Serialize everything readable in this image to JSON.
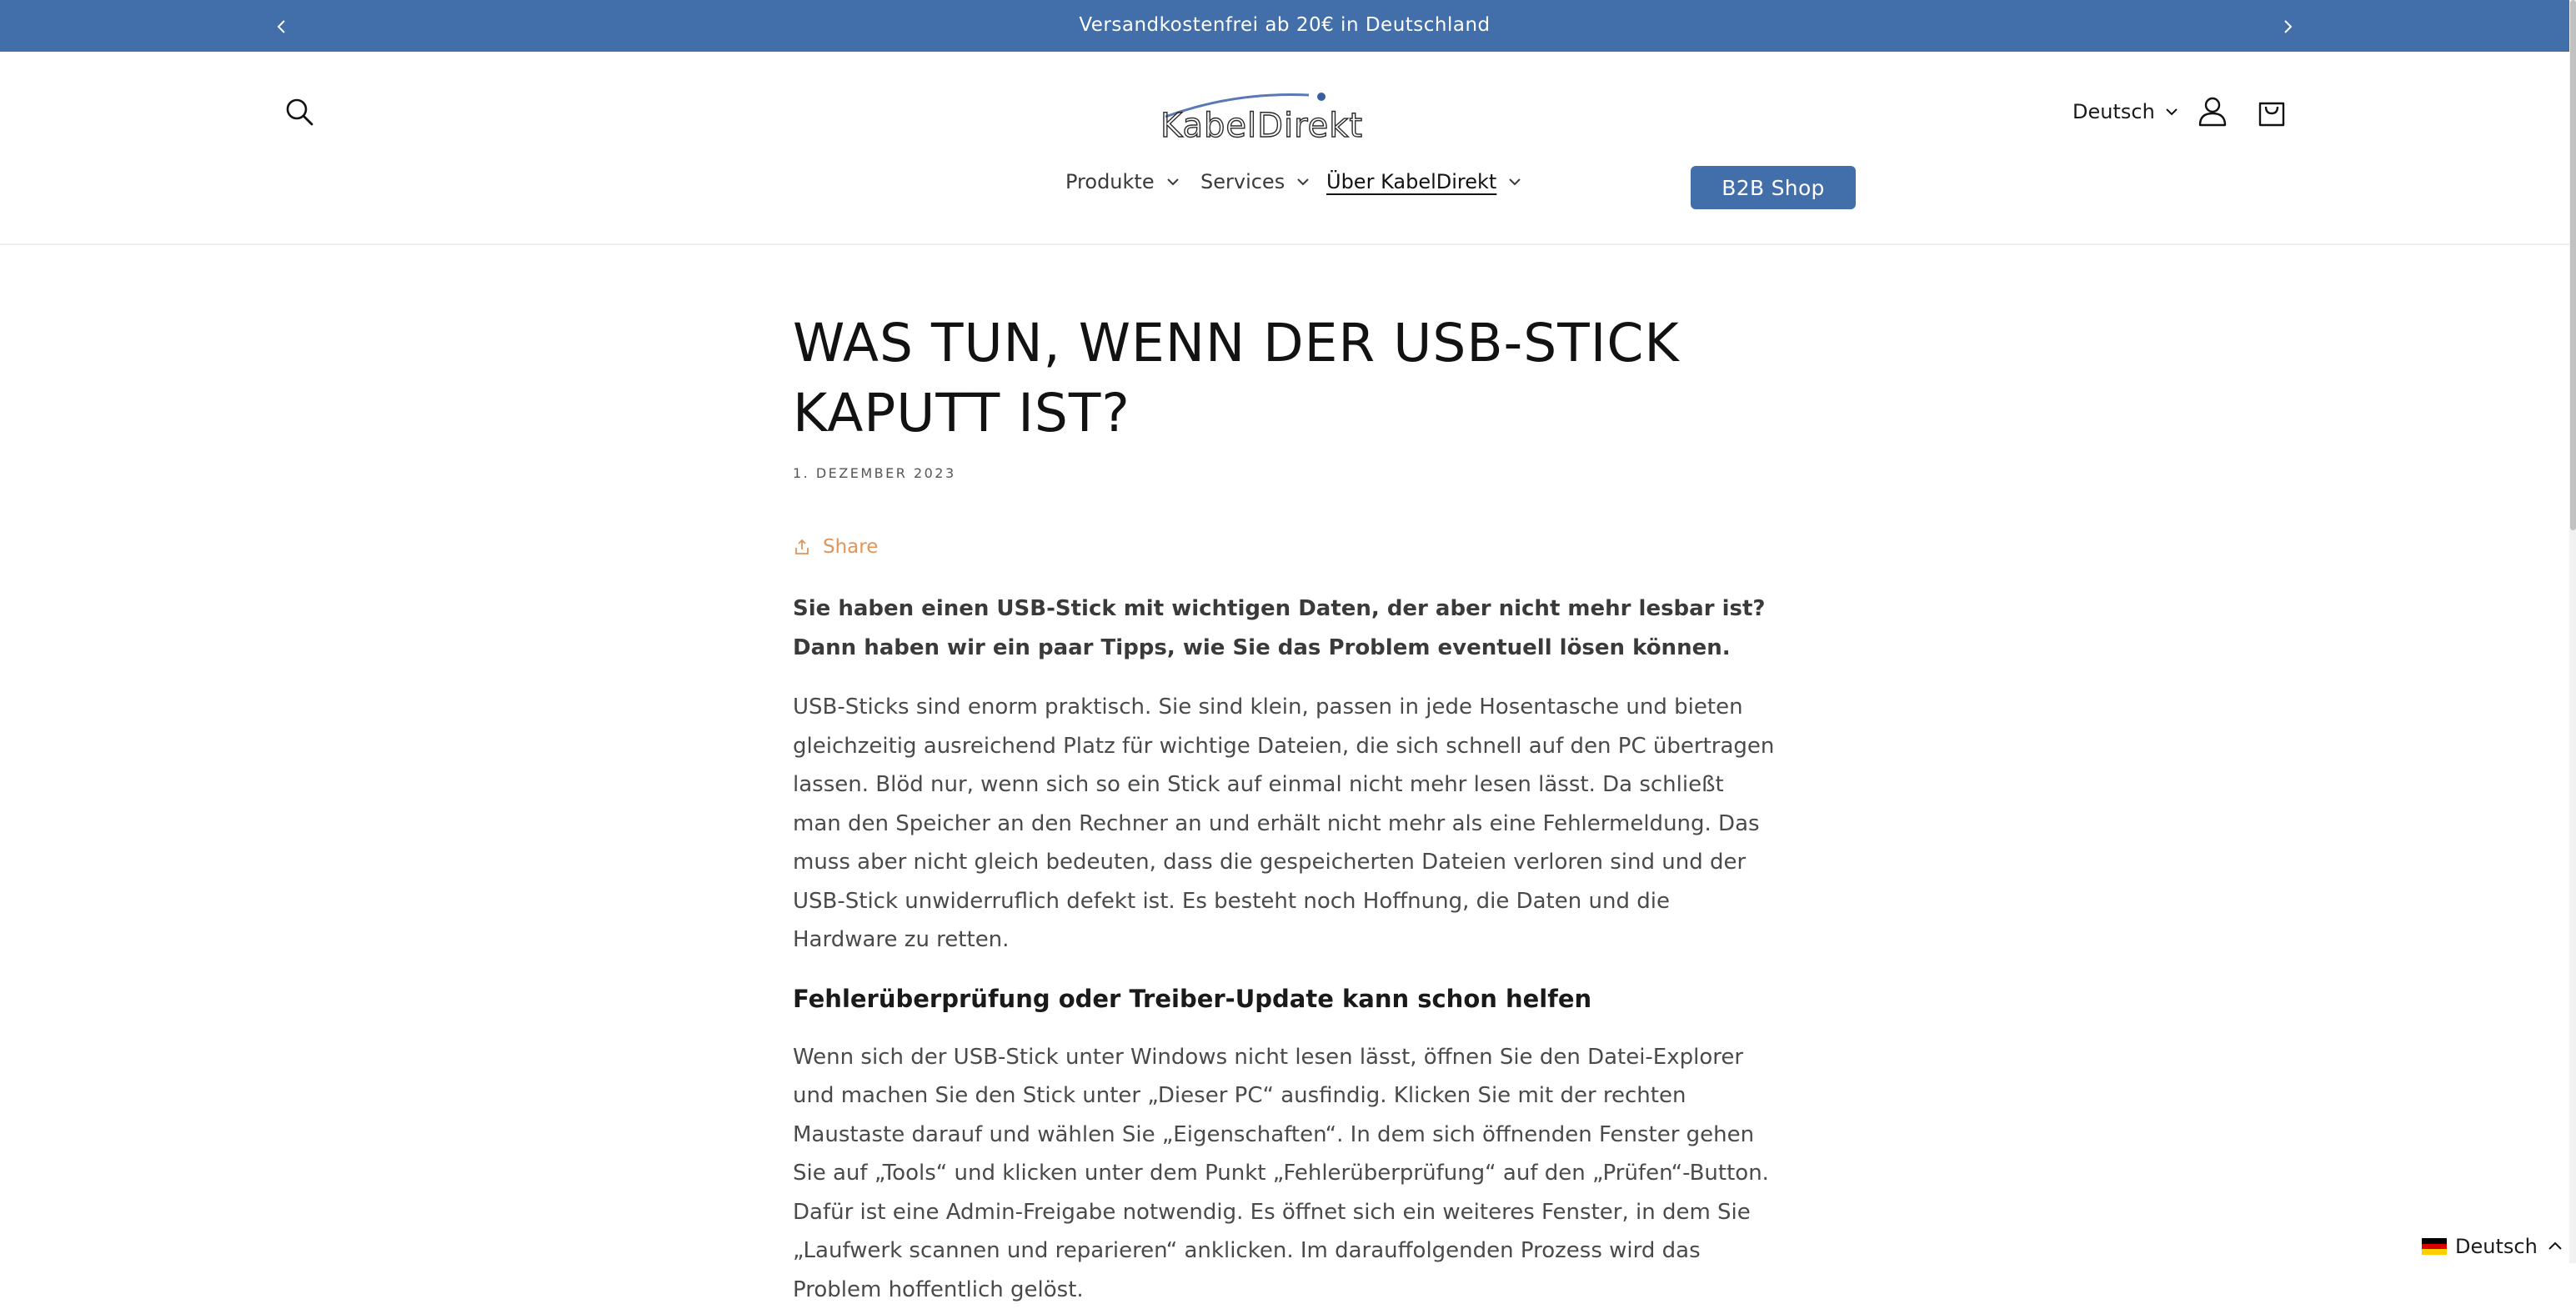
{
  "announcement": {
    "text": "Versandkostenfrei ab 20€ in Deutschland",
    "bg_color": "#426ea9"
  },
  "header": {
    "logo_text": "KabelDirekt",
    "language": "Deutsch",
    "icons": [
      "search-icon",
      "account-icon",
      "cart-icon"
    ]
  },
  "nav": {
    "items": [
      {
        "label": "Produkte"
      },
      {
        "label": "Services"
      },
      {
        "label": "Über KabelDirekt"
      }
    ],
    "b2b_label": "B2B Shop"
  },
  "article": {
    "title_line1": "WAS TUN, WENN DER USB-STICK",
    "title_line2": "KAPUTT IST?",
    "date": "1. DEZEMBER 2023",
    "share_label": "Share",
    "lead": "Sie haben einen USB-Stick mit wichtigen Daten, der aber nicht mehr lesbar ist? Dann haben wir ein paar Tipps, wie Sie das Problem eventuell lösen können.",
    "para1": "USB-Sticks sind enorm praktisch. Sie sind klein, passen in jede Hosentasche und bieten gleichzeitig ausreichend Platz für wichtige Dateien, die sich schnell auf den PC übertragen lassen. Blöd nur, wenn sich so ein Stick auf einmal nicht mehr lesen lässt. Da schließt man den Speicher an den Rechner an und erhält nicht mehr als eine Fehlermeldung. Das muss aber nicht gleich bedeuten, dass die gespeicherten Dateien verloren sind und der USB-Stick unwiderruflich defekt ist. Es besteht noch Hoffnung, die Daten und die Hardware zu retten.",
    "subhead": "Fehlerüberprüfung oder Treiber-Update kann schon helfen",
    "para2": "Wenn sich der USB-Stick unter Windows nicht lesen lässt, öffnen Sie den Datei-Explorer und machen Sie den Stick unter „Dieser PC“ ausfindig. Klicken Sie mit der rechten Maustaste darauf und wählen Sie „Eigenschaften“. In dem sich öffnenden Fenster gehen Sie auf „Tools“ und klicken unter dem Punkt „Fehlerüberprüfung“ auf den „Prüfen“-Button. Dafür ist eine Admin-Freigabe notwendig. Es öffnet sich ein weiteres Fenster, in dem Sie „Laufwerk scannen und reparieren“ anklicken. Im darauffolgenden Prozess wird das Problem hoffentlich gelöst."
  },
  "language_widget": {
    "label": "Deutsch"
  },
  "colors": {
    "accent": "#426ea9",
    "share": "#e0955a"
  }
}
